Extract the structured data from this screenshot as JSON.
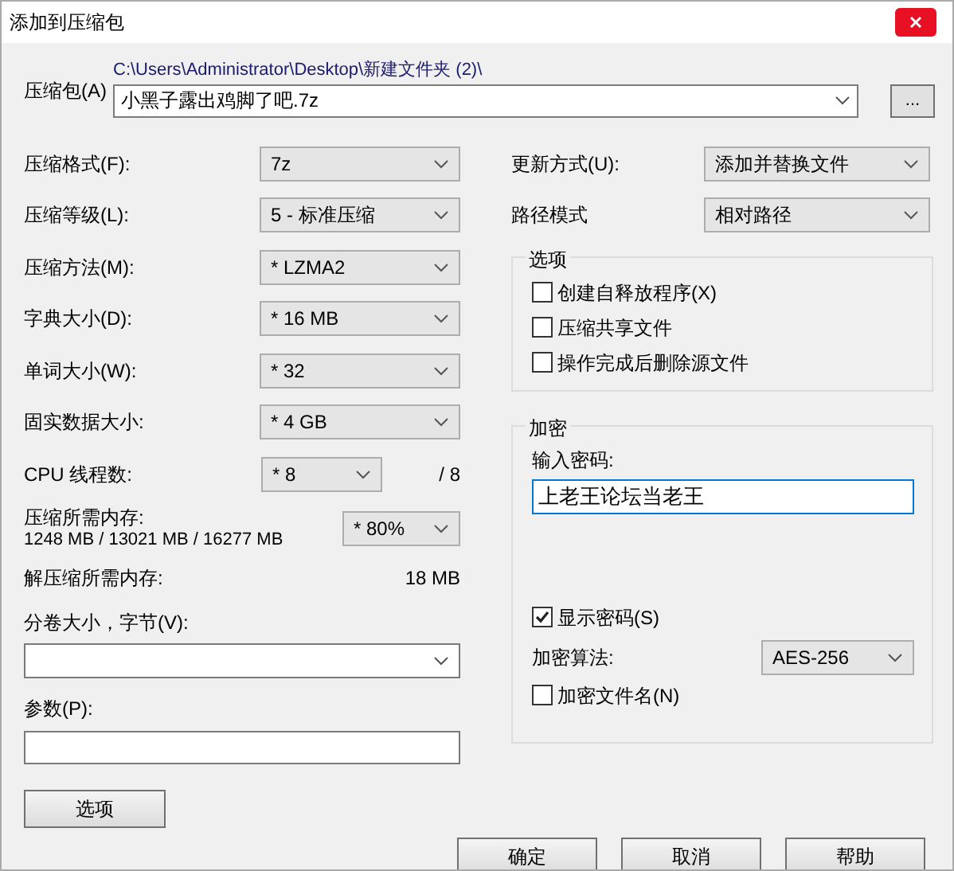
{
  "window": {
    "title": "添加到压缩包"
  },
  "archive": {
    "label": "压缩包(A)",
    "path": "C:\\Users\\Administrator\\Desktop\\新建文件夹 (2)\\",
    "value": "小黑子露出鸡脚了吧.7z",
    "browse": "..."
  },
  "settings": [
    {
      "label": "压缩格式(F):",
      "value": "7z"
    },
    {
      "label": "压缩等级(L):",
      "value": "5 - 标准压缩"
    },
    {
      "label": "压缩方法(M):",
      "value": "* LZMA2"
    },
    {
      "label": "字典大小(D):",
      "value": "* 16 MB"
    },
    {
      "label": "单词大小(W):",
      "value": "* 32"
    },
    {
      "label": "固实数据大小:",
      "value": "* 4 GB"
    }
  ],
  "cpu": {
    "label": "CPU 线程数:",
    "value": "* 8",
    "max": "/ 8"
  },
  "memory": {
    "label": "压缩所需内存:",
    "detail": "1248 MB / 13021 MB / 16277 MB",
    "value": "* 80%"
  },
  "decompress_memory": {
    "label": "解压缩所需内存:",
    "value": "18 MB"
  },
  "volume": {
    "label": "分卷大小，字节(V):"
  },
  "parameters": {
    "label": "参数(P):"
  },
  "options_button": "选项",
  "update": {
    "label": "更新方式(U):",
    "value": "添加并替换文件"
  },
  "path_mode": {
    "label": "路径模式",
    "value": "相对路径"
  },
  "options": {
    "title": "选项",
    "items": [
      {
        "label": "创建自释放程序(X)",
        "checked": false
      },
      {
        "label": "压缩共享文件",
        "checked": false
      },
      {
        "label": "操作完成后删除源文件",
        "checked": false
      }
    ]
  },
  "encryption": {
    "title": "加密",
    "password_label": "输入密码:",
    "password": "上老王论坛当老王",
    "show_password": {
      "label": "显示密码(S)",
      "checked": true
    },
    "method_label": "加密算法:",
    "method": "AES-256",
    "encrypt_names": {
      "label": "加密文件名(N)",
      "checked": false
    }
  },
  "buttons": [
    "确定",
    "取消",
    "帮助"
  ]
}
